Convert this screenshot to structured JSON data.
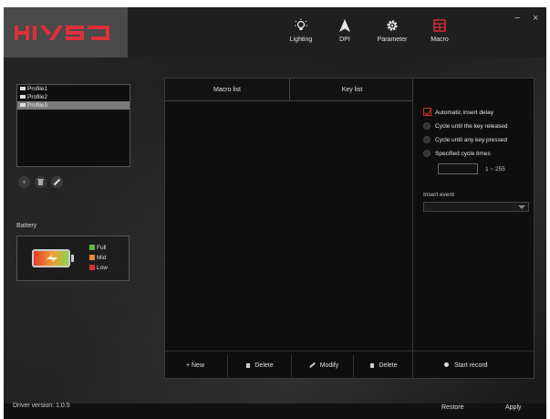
{
  "header": {
    "nav": [
      {
        "label": "Lighting",
        "icon": "lightbulb-icon"
      },
      {
        "label": "DPI",
        "icon": "arrow-cursor-icon"
      },
      {
        "label": "Parameter",
        "icon": "gear-icon"
      },
      {
        "label": "Macro",
        "icon": "macro-grid-icon"
      }
    ],
    "minimize": "−",
    "close": "×",
    "active_color": "#e0303a"
  },
  "profiles": {
    "items": [
      "Profile1",
      "Profile2",
      "Profile3"
    ],
    "selected": "Profile3",
    "tools": {
      "add": "+",
      "delete": "delete-icon",
      "edit": "pencil-icon"
    }
  },
  "battery": {
    "title": "Battery",
    "legend": [
      {
        "label": "Full",
        "color": "#5cb83a"
      },
      {
        "label": "Mid",
        "color": "#e8892a"
      },
      {
        "label": "Low",
        "color": "#e03030"
      }
    ]
  },
  "center": {
    "macro_list_header": "Macro list",
    "key_list_header": "Key list",
    "buttons": {
      "new": "+ New",
      "delete_macro": "Delete",
      "modify": "Modify",
      "delete_key": "Delete"
    }
  },
  "options": {
    "auto_insert_delay": "Automatic insert delay",
    "cycle_released": "Cycle until the key released",
    "cycle_any": "Cycle until any key pressed",
    "specified": "Specified cycle times",
    "range": "1 ~ 255",
    "insert_event_label": "Insert event",
    "start_record": "Start record"
  },
  "footer": {
    "version": "Driver version: 1.0.5",
    "restore": "Restore",
    "apply": "Apply"
  }
}
